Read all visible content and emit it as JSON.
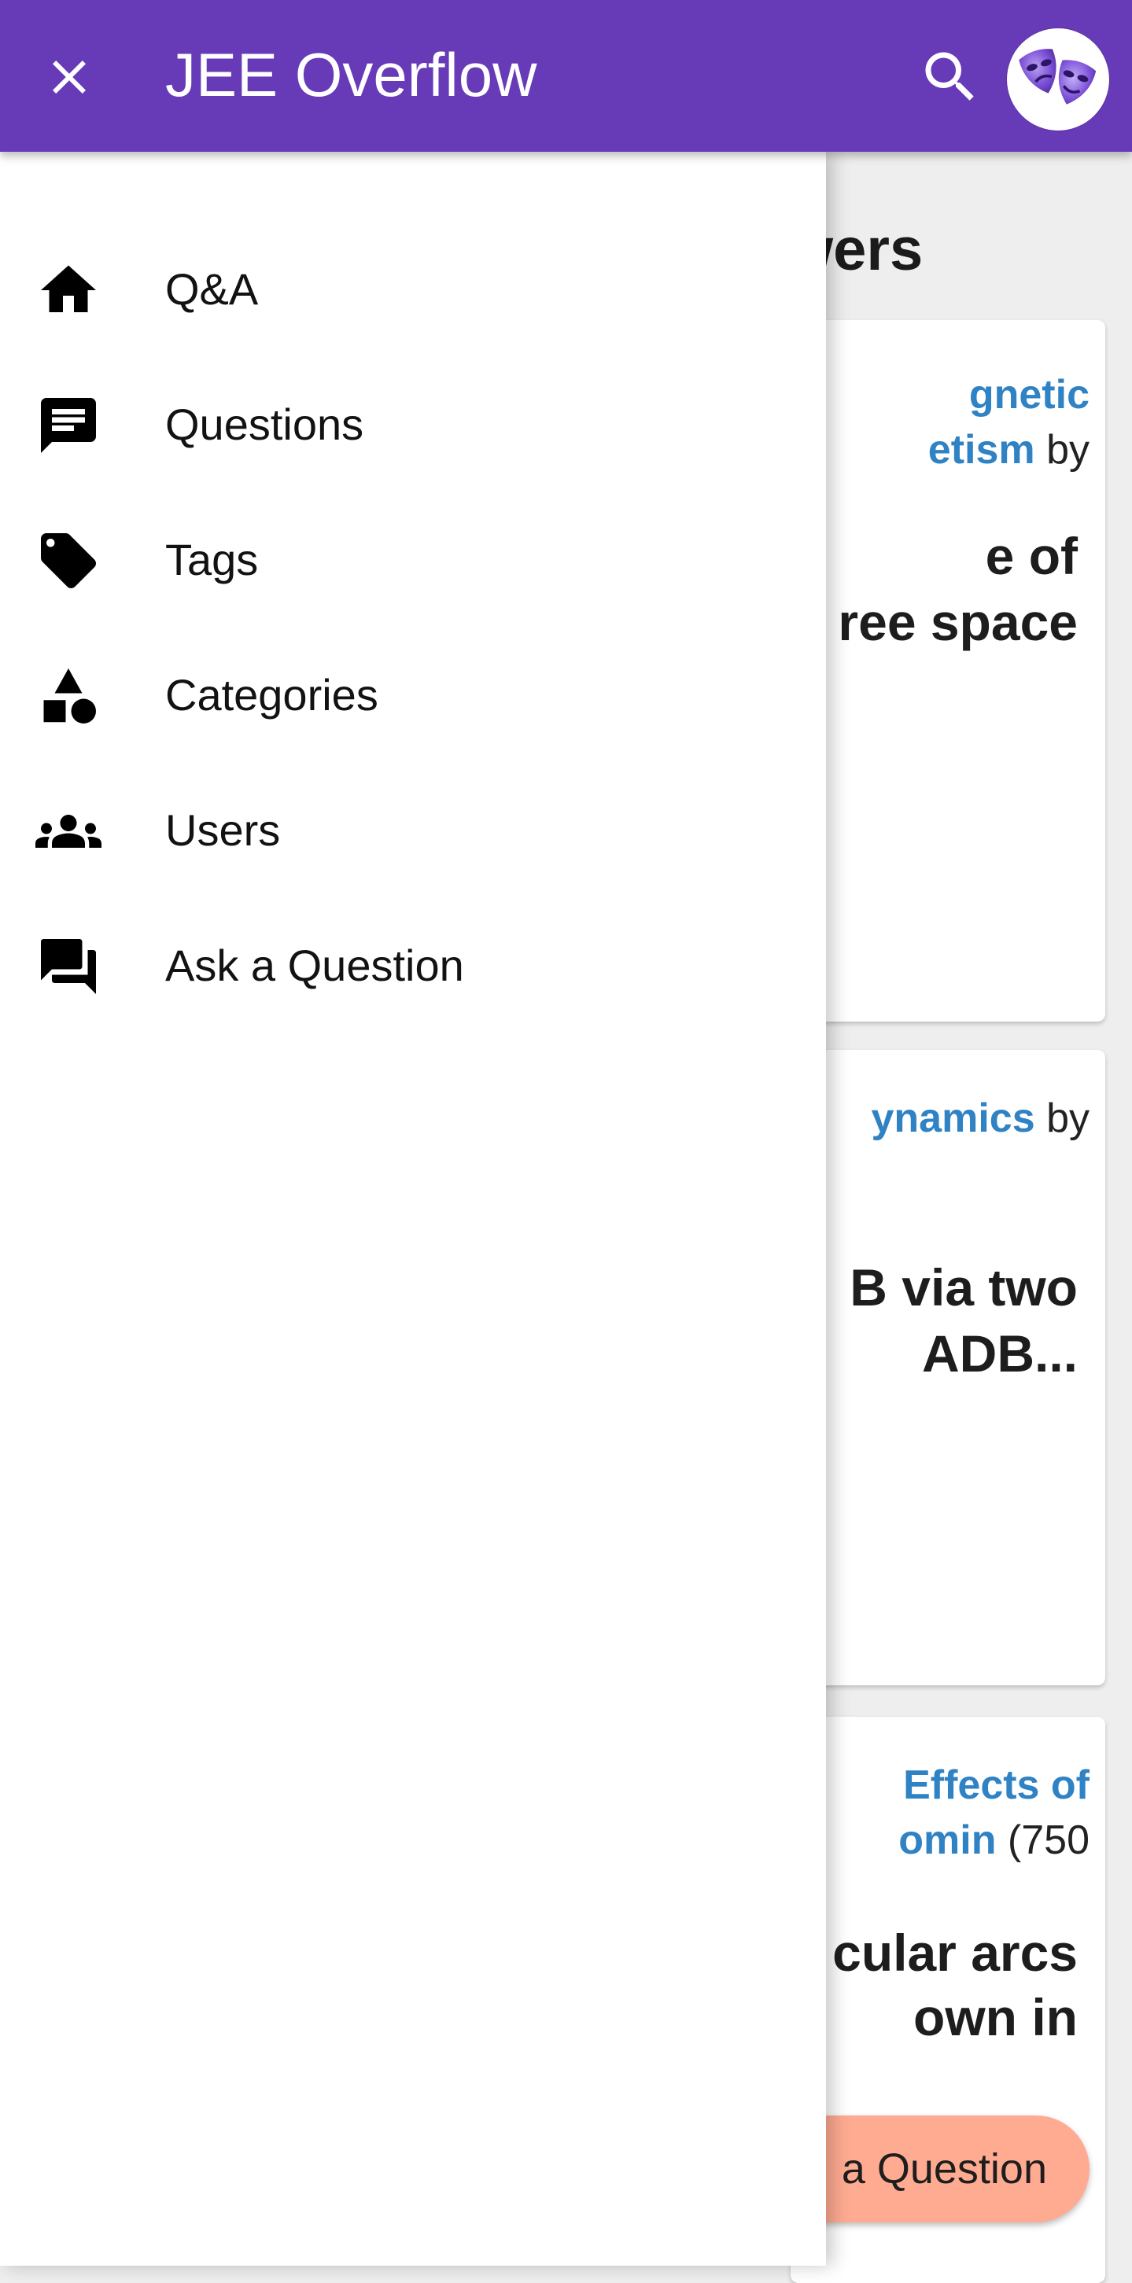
{
  "app_bar": {
    "title": "JEE Overflow",
    "close_icon": "close-icon",
    "search_icon": "search-icon",
    "avatar_icon": "theater-masks-avatar",
    "background_color": "#673ab7"
  },
  "drawer": {
    "items": [
      {
        "label": "Q&A",
        "icon": "home-icon"
      },
      {
        "label": "Questions",
        "icon": "comment-text-icon"
      },
      {
        "label": "Tags",
        "icon": "tag-icon"
      },
      {
        "label": "Categories",
        "icon": "category-shapes-icon"
      },
      {
        "label": "Users",
        "icon": "people-icon"
      },
      {
        "label": "Ask a Question",
        "icon": "forum-icon"
      }
    ]
  },
  "background": {
    "section_heading": "wers",
    "cards": [
      {
        "meta_line1_link": "gnetic",
        "meta_line2_link": "etism",
        "meta_line2_rest": " by",
        "title_line1": "e of",
        "title_line2": "ree space"
      },
      {
        "meta_line1_link": "ynamics",
        "meta_line1_rest": " by",
        "title_line1": "B via two",
        "title_line2": "ADB..."
      },
      {
        "meta_line1_link": "Effects of",
        "meta_line2_link": "omin",
        "meta_line2_rest": " (750",
        "title_line1": "cular arcs",
        "title_line2": "own in"
      }
    ],
    "fab_label": "a Question",
    "link_color": "#2f82c4",
    "fab_color": "#ffab91"
  }
}
